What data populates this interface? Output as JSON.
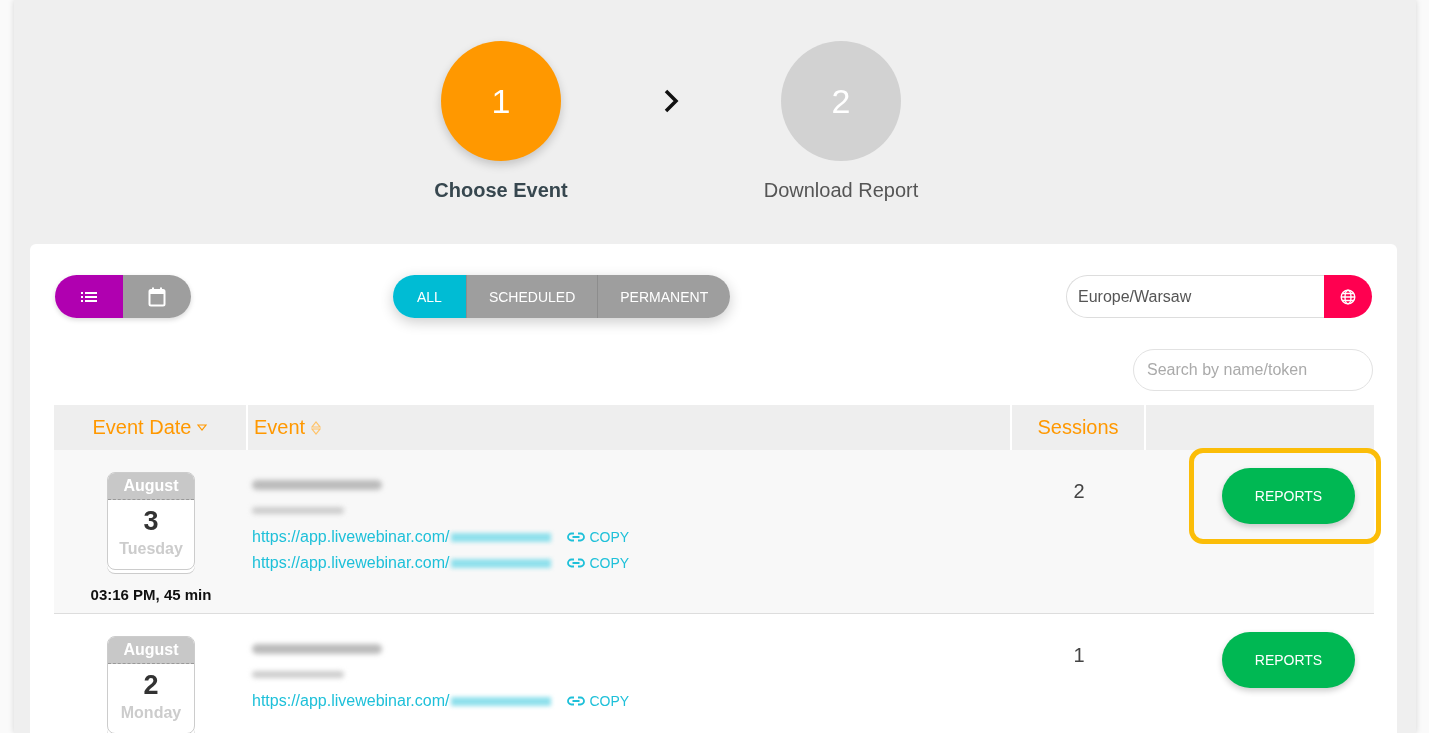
{
  "steps": [
    {
      "number": "1",
      "label": "Choose Event",
      "active": true
    },
    {
      "number": "2",
      "label": "Download Report",
      "active": false
    }
  ],
  "view_toggle": [
    {
      "kind": "list",
      "selected": true
    },
    {
      "kind": "calendar",
      "selected": false
    }
  ],
  "filters": [
    {
      "label": "ALL",
      "selected": true
    },
    {
      "label": "SCHEDULED",
      "selected": false
    },
    {
      "label": "PERMANENT",
      "selected": false
    }
  ],
  "timezone": {
    "value": "Europe/Warsaw"
  },
  "search": {
    "placeholder": "Search by name/token"
  },
  "table": {
    "columns": [
      {
        "label": "Event Date",
        "sortable": true,
        "sorted": true
      },
      {
        "label": "Event",
        "sortable": true,
        "sorted": false
      },
      {
        "label": "Sessions"
      }
    ],
    "rows": [
      {
        "month": "August",
        "day": "3",
        "weekday": "Tuesday",
        "time": "03:16 PM, 45 min",
        "name": {
          "kind": "blurred"
        },
        "token": {
          "kind": "blurred"
        },
        "links": [
          {
            "url": "https://app.livewebinar.com/",
            "copy": "COPY"
          },
          {
            "url": "https://app.livewebinar.com/",
            "copy": "COPY"
          }
        ],
        "sessions": "2",
        "action": "REPORTS",
        "highlighted": true
      },
      {
        "month": "August",
        "day": "2",
        "weekday": "Monday",
        "name": {
          "kind": "blurred"
        },
        "token": {
          "kind": "blurred"
        },
        "links": [
          {
            "url": "https://app.livewebinar.com/",
            "copy": "COPY"
          }
        ],
        "sessions": "1",
        "action": "REPORTS",
        "highlighted": false
      }
    ]
  }
}
